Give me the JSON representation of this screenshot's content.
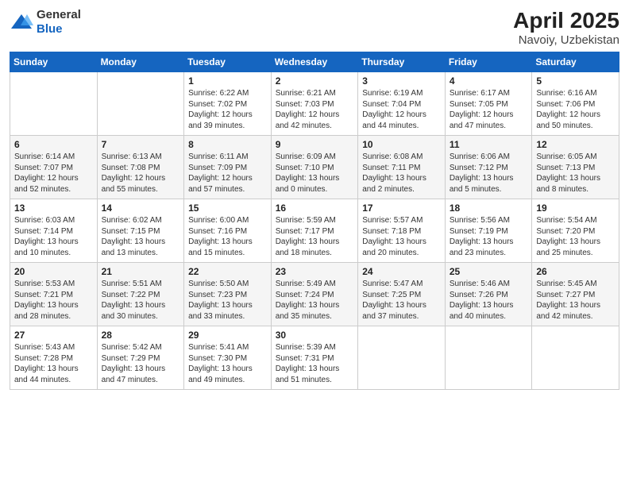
{
  "header": {
    "logo_general": "General",
    "logo_blue": "Blue",
    "month": "April 2025",
    "location": "Navoiy, Uzbekistan"
  },
  "weekdays": [
    "Sunday",
    "Monday",
    "Tuesday",
    "Wednesday",
    "Thursday",
    "Friday",
    "Saturday"
  ],
  "weeks": [
    [
      {
        "day": "",
        "sunrise": "",
        "sunset": "",
        "daylight": ""
      },
      {
        "day": "",
        "sunrise": "",
        "sunset": "",
        "daylight": ""
      },
      {
        "day": "1",
        "sunrise": "Sunrise: 6:22 AM",
        "sunset": "Sunset: 7:02 PM",
        "daylight": "Daylight: 12 hours and 39 minutes."
      },
      {
        "day": "2",
        "sunrise": "Sunrise: 6:21 AM",
        "sunset": "Sunset: 7:03 PM",
        "daylight": "Daylight: 12 hours and 42 minutes."
      },
      {
        "day": "3",
        "sunrise": "Sunrise: 6:19 AM",
        "sunset": "Sunset: 7:04 PM",
        "daylight": "Daylight: 12 hours and 44 minutes."
      },
      {
        "day": "4",
        "sunrise": "Sunrise: 6:17 AM",
        "sunset": "Sunset: 7:05 PM",
        "daylight": "Daylight: 12 hours and 47 minutes."
      },
      {
        "day": "5",
        "sunrise": "Sunrise: 6:16 AM",
        "sunset": "Sunset: 7:06 PM",
        "daylight": "Daylight: 12 hours and 50 minutes."
      }
    ],
    [
      {
        "day": "6",
        "sunrise": "Sunrise: 6:14 AM",
        "sunset": "Sunset: 7:07 PM",
        "daylight": "Daylight: 12 hours and 52 minutes."
      },
      {
        "day": "7",
        "sunrise": "Sunrise: 6:13 AM",
        "sunset": "Sunset: 7:08 PM",
        "daylight": "Daylight: 12 hours and 55 minutes."
      },
      {
        "day": "8",
        "sunrise": "Sunrise: 6:11 AM",
        "sunset": "Sunset: 7:09 PM",
        "daylight": "Daylight: 12 hours and 57 minutes."
      },
      {
        "day": "9",
        "sunrise": "Sunrise: 6:09 AM",
        "sunset": "Sunset: 7:10 PM",
        "daylight": "Daylight: 13 hours and 0 minutes."
      },
      {
        "day": "10",
        "sunrise": "Sunrise: 6:08 AM",
        "sunset": "Sunset: 7:11 PM",
        "daylight": "Daylight: 13 hours and 2 minutes."
      },
      {
        "day": "11",
        "sunrise": "Sunrise: 6:06 AM",
        "sunset": "Sunset: 7:12 PM",
        "daylight": "Daylight: 13 hours and 5 minutes."
      },
      {
        "day": "12",
        "sunrise": "Sunrise: 6:05 AM",
        "sunset": "Sunset: 7:13 PM",
        "daylight": "Daylight: 13 hours and 8 minutes."
      }
    ],
    [
      {
        "day": "13",
        "sunrise": "Sunrise: 6:03 AM",
        "sunset": "Sunset: 7:14 PM",
        "daylight": "Daylight: 13 hours and 10 minutes."
      },
      {
        "day": "14",
        "sunrise": "Sunrise: 6:02 AM",
        "sunset": "Sunset: 7:15 PM",
        "daylight": "Daylight: 13 hours and 13 minutes."
      },
      {
        "day": "15",
        "sunrise": "Sunrise: 6:00 AM",
        "sunset": "Sunset: 7:16 PM",
        "daylight": "Daylight: 13 hours and 15 minutes."
      },
      {
        "day": "16",
        "sunrise": "Sunrise: 5:59 AM",
        "sunset": "Sunset: 7:17 PM",
        "daylight": "Daylight: 13 hours and 18 minutes."
      },
      {
        "day": "17",
        "sunrise": "Sunrise: 5:57 AM",
        "sunset": "Sunset: 7:18 PM",
        "daylight": "Daylight: 13 hours and 20 minutes."
      },
      {
        "day": "18",
        "sunrise": "Sunrise: 5:56 AM",
        "sunset": "Sunset: 7:19 PM",
        "daylight": "Daylight: 13 hours and 23 minutes."
      },
      {
        "day": "19",
        "sunrise": "Sunrise: 5:54 AM",
        "sunset": "Sunset: 7:20 PM",
        "daylight": "Daylight: 13 hours and 25 minutes."
      }
    ],
    [
      {
        "day": "20",
        "sunrise": "Sunrise: 5:53 AM",
        "sunset": "Sunset: 7:21 PM",
        "daylight": "Daylight: 13 hours and 28 minutes."
      },
      {
        "day": "21",
        "sunrise": "Sunrise: 5:51 AM",
        "sunset": "Sunset: 7:22 PM",
        "daylight": "Daylight: 13 hours and 30 minutes."
      },
      {
        "day": "22",
        "sunrise": "Sunrise: 5:50 AM",
        "sunset": "Sunset: 7:23 PM",
        "daylight": "Daylight: 13 hours and 33 minutes."
      },
      {
        "day": "23",
        "sunrise": "Sunrise: 5:49 AM",
        "sunset": "Sunset: 7:24 PM",
        "daylight": "Daylight: 13 hours and 35 minutes."
      },
      {
        "day": "24",
        "sunrise": "Sunrise: 5:47 AM",
        "sunset": "Sunset: 7:25 PM",
        "daylight": "Daylight: 13 hours and 37 minutes."
      },
      {
        "day": "25",
        "sunrise": "Sunrise: 5:46 AM",
        "sunset": "Sunset: 7:26 PM",
        "daylight": "Daylight: 13 hours and 40 minutes."
      },
      {
        "day": "26",
        "sunrise": "Sunrise: 5:45 AM",
        "sunset": "Sunset: 7:27 PM",
        "daylight": "Daylight: 13 hours and 42 minutes."
      }
    ],
    [
      {
        "day": "27",
        "sunrise": "Sunrise: 5:43 AM",
        "sunset": "Sunset: 7:28 PM",
        "daylight": "Daylight: 13 hours and 44 minutes."
      },
      {
        "day": "28",
        "sunrise": "Sunrise: 5:42 AM",
        "sunset": "Sunset: 7:29 PM",
        "daylight": "Daylight: 13 hours and 47 minutes."
      },
      {
        "day": "29",
        "sunrise": "Sunrise: 5:41 AM",
        "sunset": "Sunset: 7:30 PM",
        "daylight": "Daylight: 13 hours and 49 minutes."
      },
      {
        "day": "30",
        "sunrise": "Sunrise: 5:39 AM",
        "sunset": "Sunset: 7:31 PM",
        "daylight": "Daylight: 13 hours and 51 minutes."
      },
      {
        "day": "",
        "sunrise": "",
        "sunset": "",
        "daylight": ""
      },
      {
        "day": "",
        "sunrise": "",
        "sunset": "",
        "daylight": ""
      },
      {
        "day": "",
        "sunrise": "",
        "sunset": "",
        "daylight": ""
      }
    ]
  ]
}
